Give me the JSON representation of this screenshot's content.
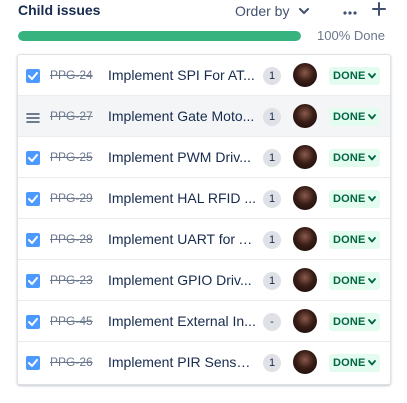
{
  "header": {
    "title": "Child issues",
    "order_by_label": "Order by",
    "more_icon": "more-icon",
    "add_icon": "plus-icon"
  },
  "progress": {
    "percent": 100,
    "label": "100% Done",
    "fill_color": "#36b37e"
  },
  "issues": [
    {
      "key": "PPG-24",
      "summary": "Implement SPI For AT...",
      "points": "1",
      "status": "DONE",
      "handle": "checkbox"
    },
    {
      "key": "PPG-27",
      "summary": "Implement Gate Moto...",
      "points": "1",
      "status": "DONE",
      "handle": "drag"
    },
    {
      "key": "PPG-25",
      "summary": "Implement PWM Driv...",
      "points": "1",
      "status": "DONE",
      "handle": "checkbox"
    },
    {
      "key": "PPG-29",
      "summary": "Implement HAL RFID ...",
      "points": "1",
      "status": "DONE",
      "handle": "checkbox"
    },
    {
      "key": "PPG-28",
      "summary": "Implement UART for A...",
      "points": "1",
      "status": "DONE",
      "handle": "checkbox"
    },
    {
      "key": "PPG-23",
      "summary": "Implement GPIO Driv...",
      "points": "1",
      "status": "DONE",
      "handle": "checkbox"
    },
    {
      "key": "PPG-45",
      "summary": "Implement External In...",
      "points": "-",
      "status": "DONE",
      "handle": "checkbox"
    },
    {
      "key": "PPG-26",
      "summary": "Implement PIR Sensor...",
      "points": "1",
      "status": "DONE",
      "handle": "checkbox"
    }
  ],
  "colors": {
    "status_bg": "#e3fcef",
    "status_text": "#006644",
    "checkbox": "#4c9aff"
  }
}
